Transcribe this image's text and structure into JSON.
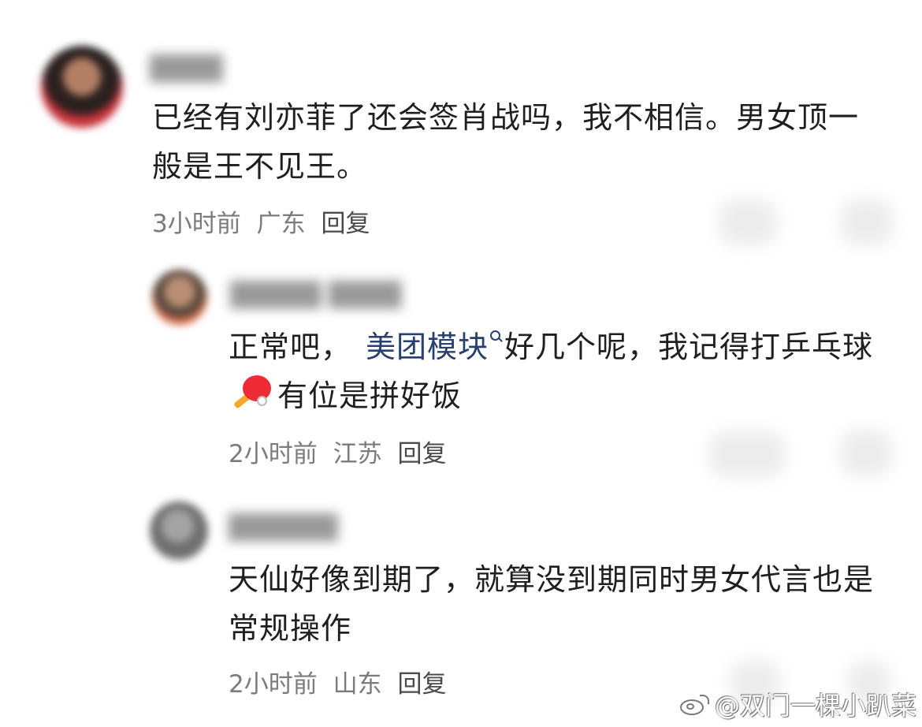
{
  "comments": [
    {
      "username": "████",
      "text": "已经有刘亦菲了还会签肖战吗，我不相信。男女顶一般是王不见王。",
      "time": "3小时前",
      "location": "广东",
      "reply_label": "回复"
    },
    {
      "username": "█████ ████",
      "text_before_link": "正常吧，",
      "link": "美团模块",
      "text_after_link": "好几个呢，我记得打乒乓球",
      "text_after_emoji": "有位是拼好饭",
      "time": "2小时前",
      "location": "江苏",
      "reply_label": "回复"
    },
    {
      "username": "██████",
      "text": "天仙好像到期了，就算没到期同时男女代言也是常规操作",
      "time": "2小时前",
      "location": "山东",
      "reply_label": "回复"
    }
  ],
  "watermark": "@双门一棵小趴菜",
  "icons": {
    "search": "search-icon",
    "emoji": "ping-pong-emoji",
    "logo": "weibo-logo-icon",
    "like": "like-icon",
    "dislike": "dislike-icon"
  },
  "colors": {
    "link": "#28406f",
    "meta": "#7b7b7b",
    "text": "#1f1f1f"
  }
}
